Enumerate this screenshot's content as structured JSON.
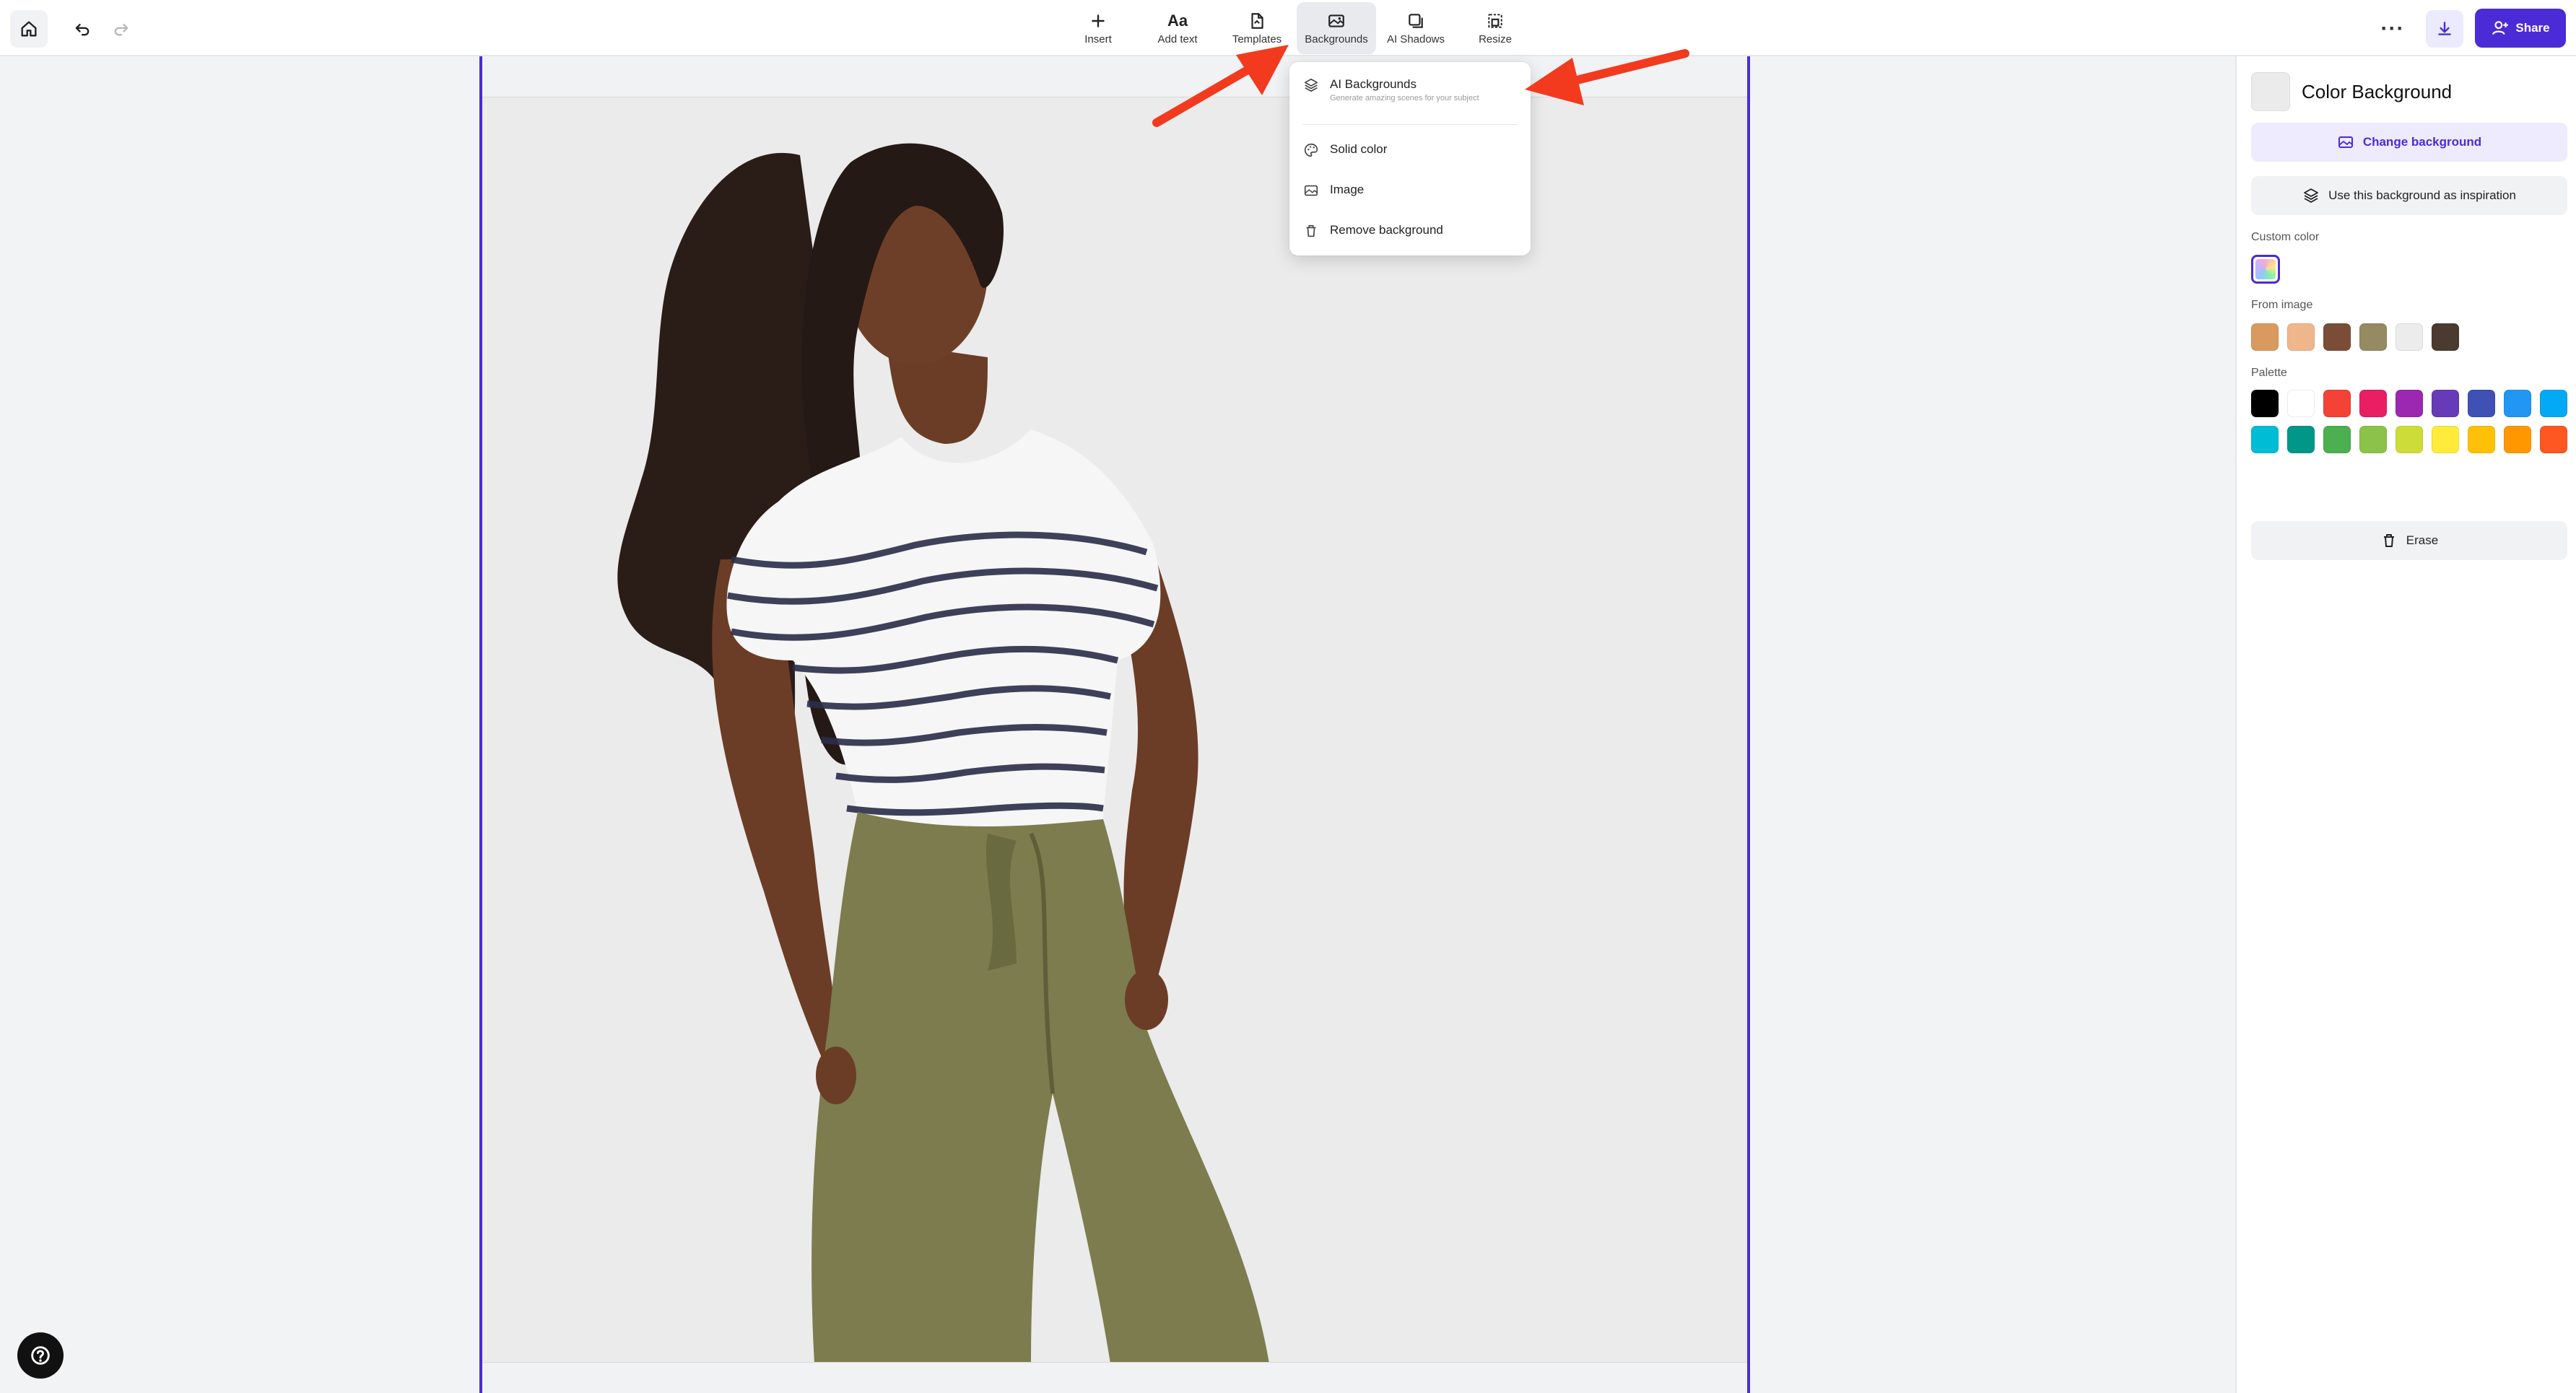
{
  "toolbar": {
    "tools": [
      {
        "label": "Insert",
        "icon": "plus-icon"
      },
      {
        "label": "Add text",
        "icon": "text-icon",
        "glyph": "Aa"
      },
      {
        "label": "Templates",
        "icon": "templates-icon"
      },
      {
        "label": "Backgrounds",
        "icon": "backgrounds-icon",
        "active": true
      },
      {
        "label": "AI Shadows",
        "icon": "shadows-icon"
      },
      {
        "label": "Resize",
        "icon": "resize-icon"
      }
    ],
    "more": "···",
    "share_label": "Share"
  },
  "dropdown": {
    "items": [
      {
        "label": "AI Backgrounds",
        "sublabel": "Generate amazing scenes for your subject",
        "icon": "layers-icon"
      },
      {
        "label": "Solid color",
        "icon": "palette-icon"
      },
      {
        "label": "Image",
        "icon": "image-icon"
      },
      {
        "label": "Remove background",
        "icon": "trash-icon"
      }
    ]
  },
  "panel": {
    "title": "Color Background",
    "current_color": "#ebebeb",
    "change_background_label": "Change background",
    "inspiration_label": "Use this background as inspiration",
    "custom_color_label": "Custom color",
    "from_image_label": "From image",
    "from_image_colors": [
      "#d99a5f",
      "#efb68c",
      "#7a4e36",
      "#958a62",
      "#ececec",
      "#4a3a30"
    ],
    "palette_label": "Palette",
    "palette_colors": [
      "#000000",
      "#ffffff",
      "#f44336",
      "#e91e63",
      "#9c27b0",
      "#673ab7",
      "#3f51b5",
      "#2196f3",
      "#03a9f4",
      "#00bcd4",
      "#009688",
      "#4caf50",
      "#8bc34a",
      "#cddc39",
      "#ffeb3b",
      "#ffc107",
      "#ff9800",
      "#ff5722"
    ],
    "erase_label": "Erase"
  },
  "colors": {
    "accent": "#4b2bd6",
    "arrow": "#f23a1f"
  }
}
